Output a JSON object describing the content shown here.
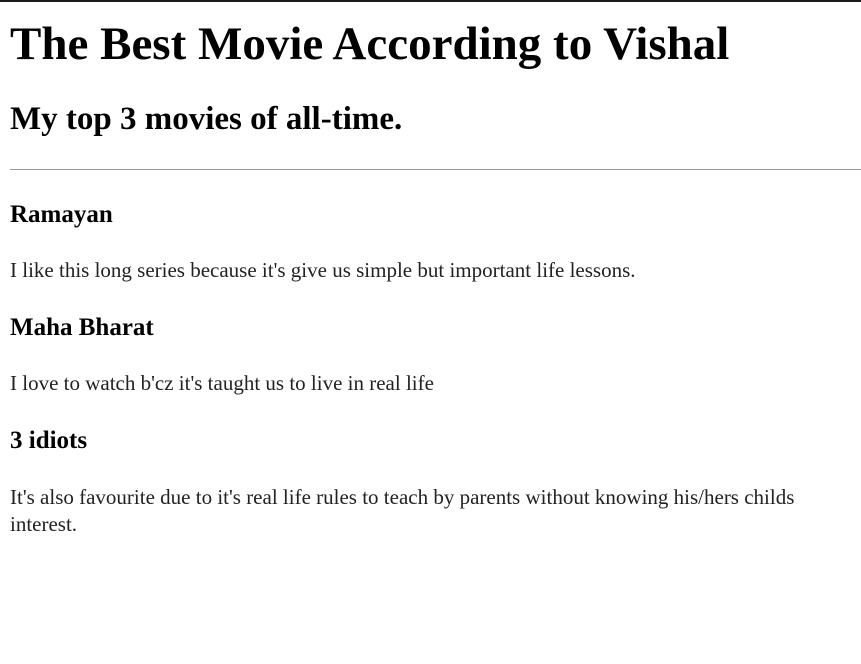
{
  "page": {
    "heading": "The Best Movie According to Vishal",
    "subheading": "My top 3 movies of all-time."
  },
  "movies": [
    {
      "title": "Ramayan",
      "description": "I like this long series because it's give us simple but important life lessons."
    },
    {
      "title": "Maha Bharat",
      "description": "I love to watch b'cz it's taught us to live in real life"
    },
    {
      "title": "3 idiots",
      "description": "It's also favourite due to it's real life rules to teach by parents without knowing his/hers childs interest."
    }
  ]
}
